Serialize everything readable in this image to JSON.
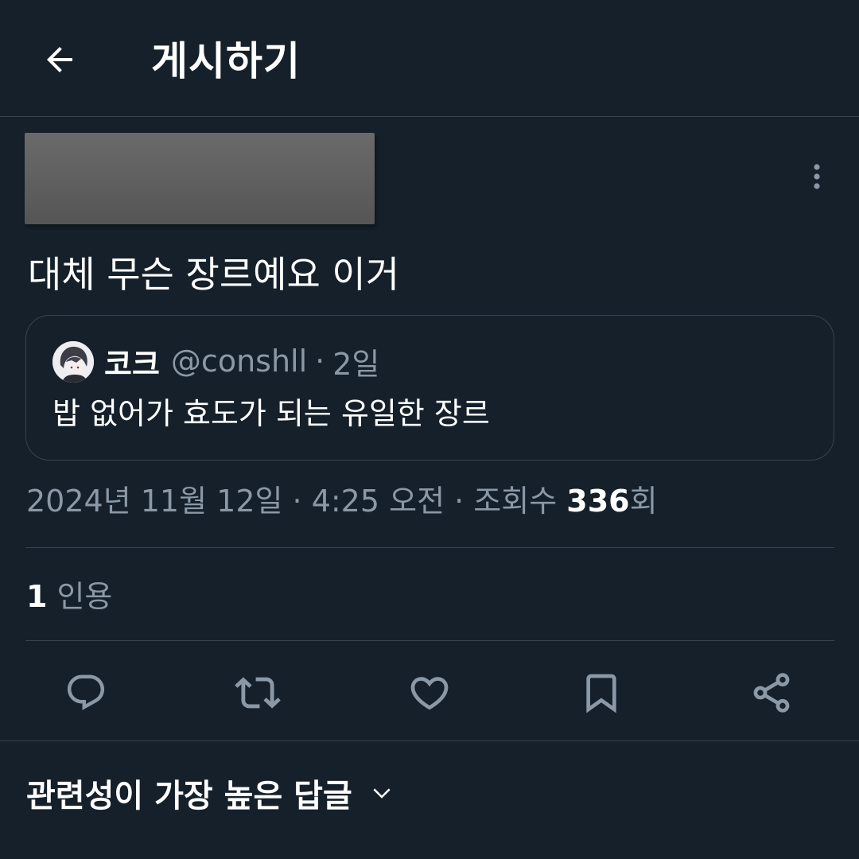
{
  "header": {
    "title": "게시하기",
    "back_icon": "arrow-left-icon"
  },
  "post": {
    "text": "대체 무슨 장르예요 이거",
    "more_icon": "more-vertical-icon"
  },
  "quoted_post": {
    "name": "코크",
    "handle": "@conshll",
    "separator": "·",
    "time": "2일",
    "text": "밥 없어가 효도가 되는 유일한 장르"
  },
  "meta": {
    "date": "2024년 11월 12일",
    "sep1": " · ",
    "time": "4:25 오전",
    "sep2": " · ",
    "views_prefix": "조회수 ",
    "views_count": "336",
    "views_suffix": "회"
  },
  "stats": {
    "quotes_count": "1",
    "quotes_label": "인용"
  },
  "actions": [
    {
      "name": "reply",
      "icon": "reply-icon"
    },
    {
      "name": "retweet",
      "icon": "retweet-icon"
    },
    {
      "name": "like",
      "icon": "heart-icon"
    },
    {
      "name": "bookmark",
      "icon": "bookmark-icon"
    },
    {
      "name": "share",
      "icon": "share-icon"
    }
  ],
  "replies": {
    "sort_label": "관련성이 가장 높은 답글",
    "sort_icon": "chevron-down-icon"
  },
  "colors": {
    "background": "#15202b",
    "border": "#38444d",
    "secondary_text": "#8b98a5",
    "primary_text": "#ffffff"
  }
}
